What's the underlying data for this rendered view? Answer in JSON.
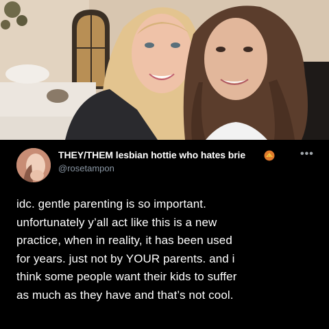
{
  "photo": {
    "description_icon": "photo-of-two-people"
  },
  "tweet": {
    "display_name": "THEY/THEM lesbian hottie who hates brie",
    "handle": "@rosetampon",
    "name_emoji": "cheese-emoji-icon",
    "more_icon": "more-options-icon",
    "more_label": "•••",
    "body_lines": [
      "idc. gentle parenting is so important.",
      "unfortunately y’all act like this is a new",
      "practice, when in reality, it has been used",
      "for years. just not by YOUR parents. and i",
      "think some people want their kids to suffer",
      "as much as they have and that’s not cool."
    ]
  },
  "colors": {
    "background": "#000000",
    "text": "#ffffff",
    "handle": "#8b98a5"
  }
}
